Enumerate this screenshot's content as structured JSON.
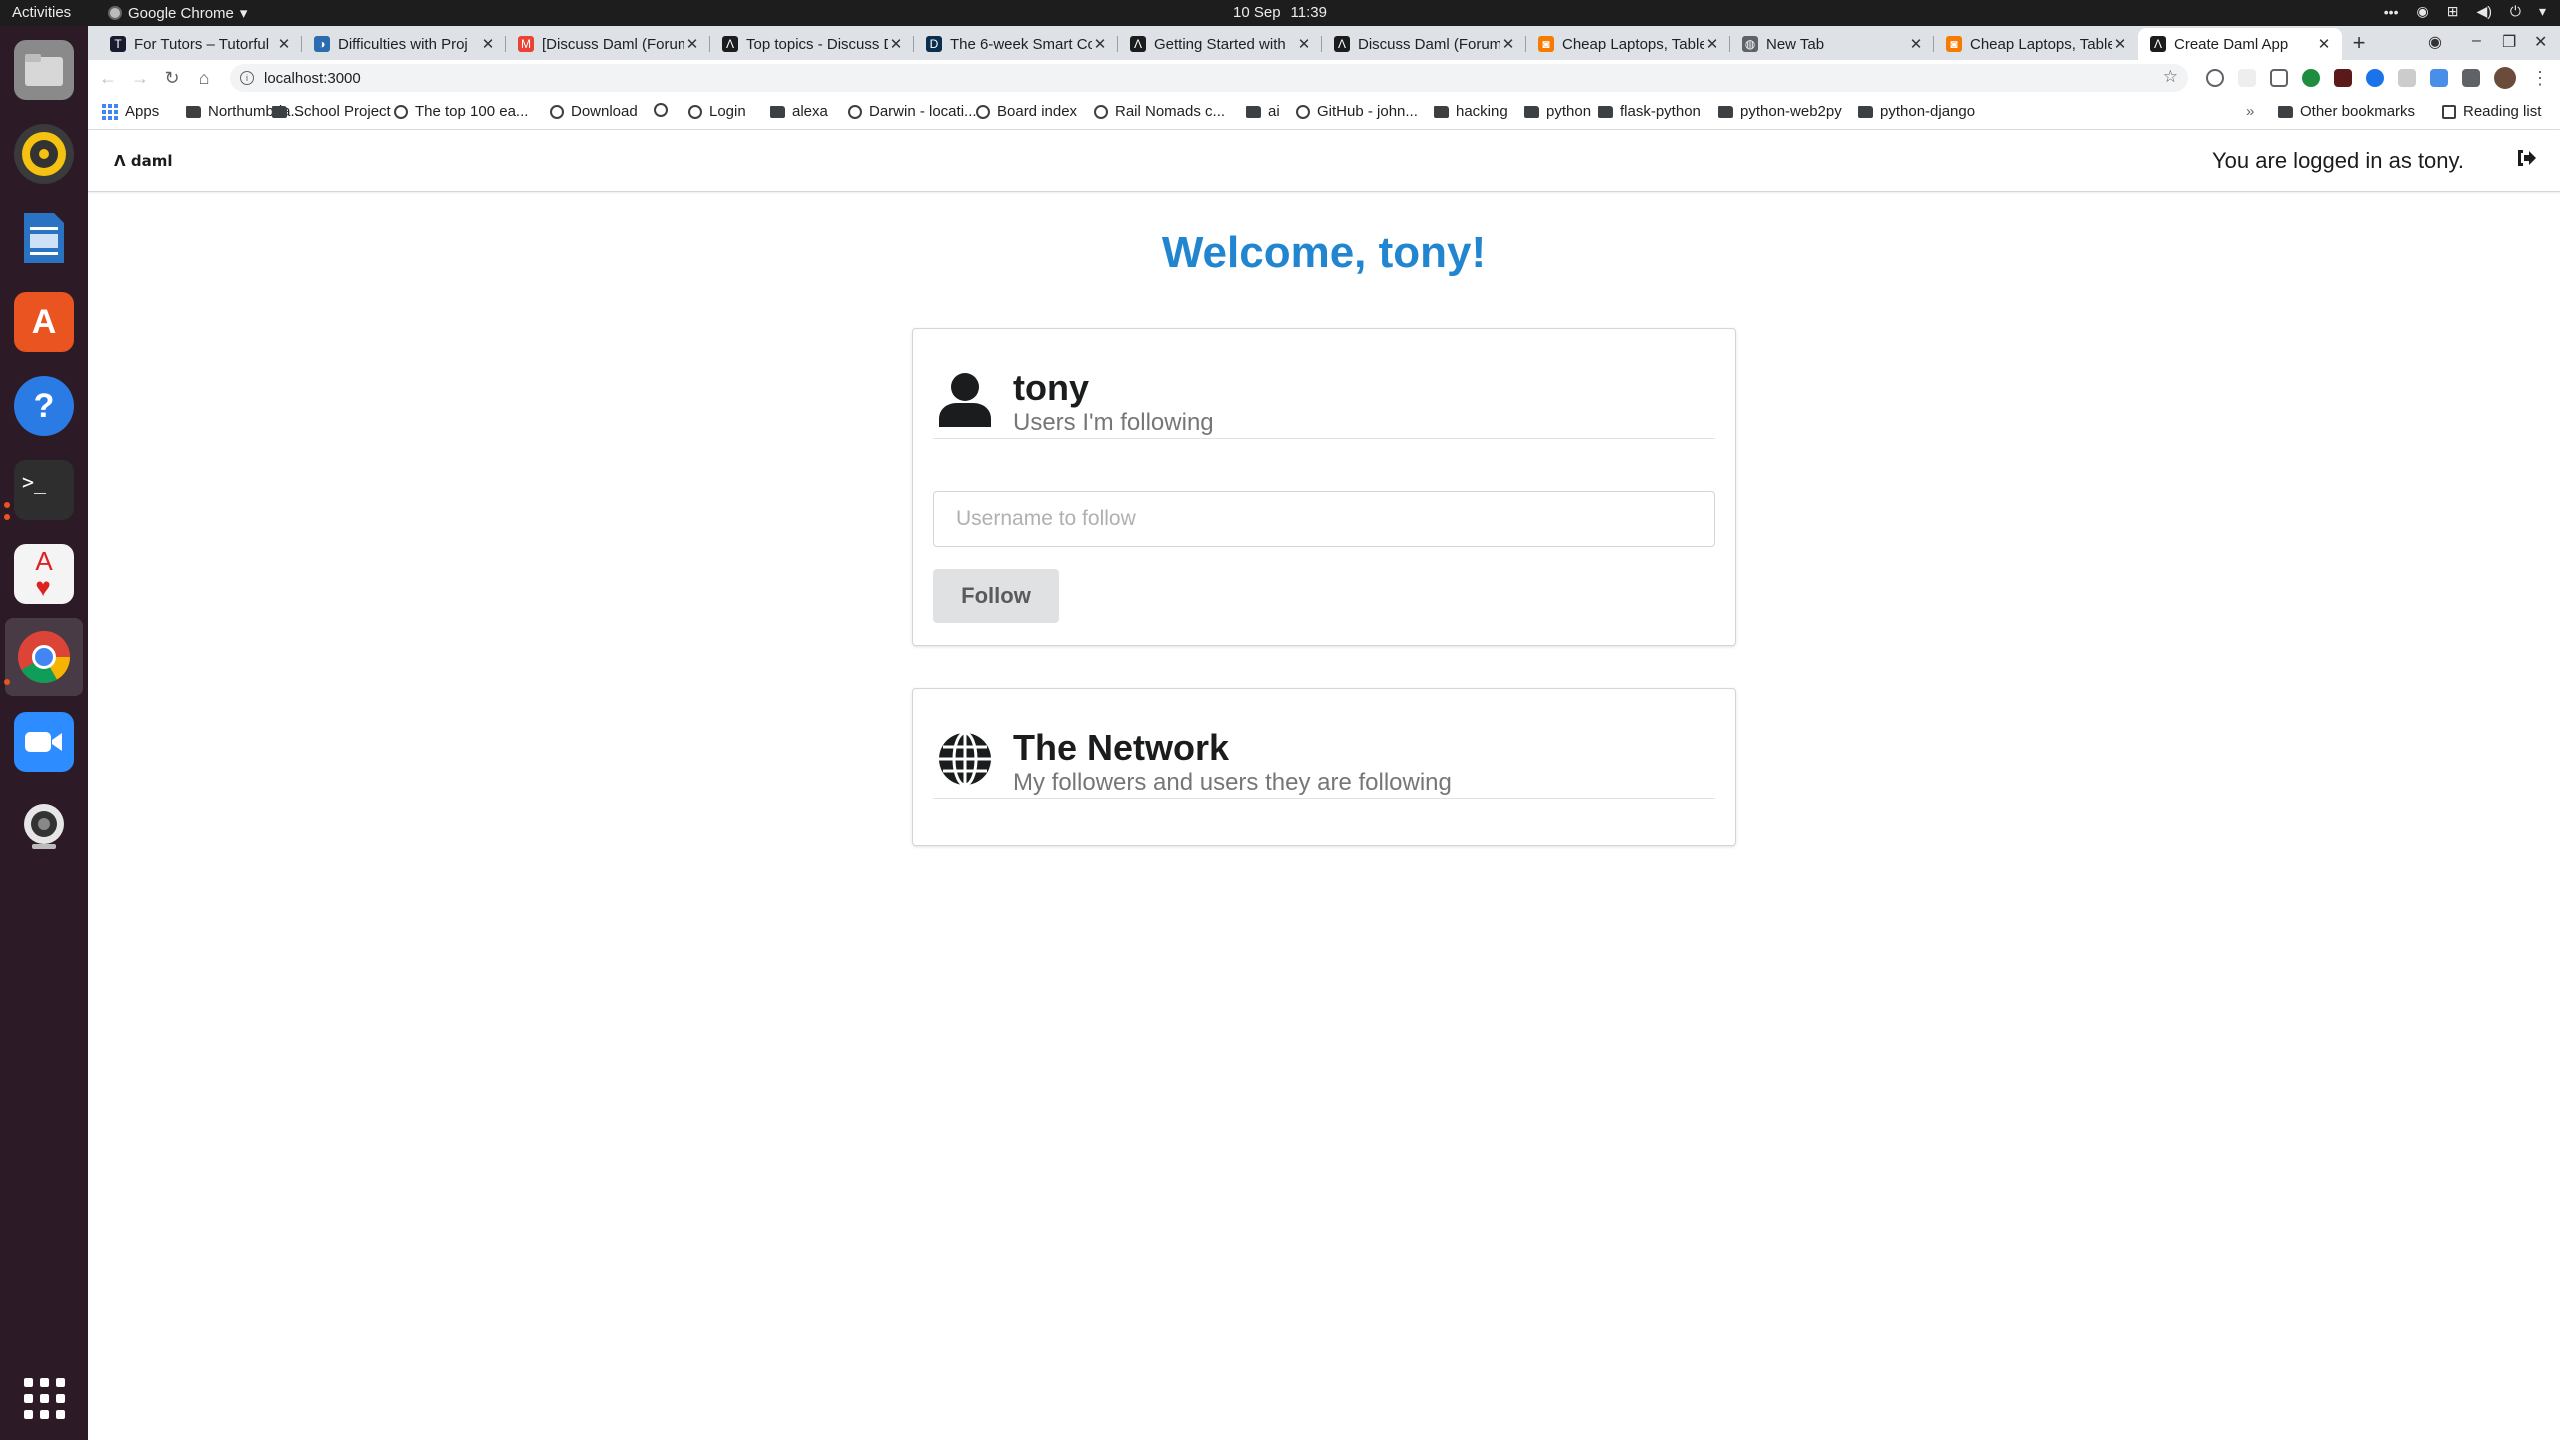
{
  "os": {
    "activities": "Activities",
    "app_name": "Google Chrome",
    "clock": {
      "date": "10 Sep",
      "time": "11:39"
    }
  },
  "dock": [
    "files-icon",
    "rhythmbox-icon",
    "writer-icon",
    "app-center-icon",
    "help-icon",
    "terminal-icon",
    "solitaire-icon",
    "chrome-icon",
    "zoom-icon",
    "webcam-icon",
    "show-apps-icon"
  ],
  "tabs": [
    {
      "title": "For Tutors – Tutorful",
      "color": "#1a1a2e",
      "glyph": "T"
    },
    {
      "title": "Difficulties with Proj",
      "color": "#2b6cb0",
      "glyph": "◑"
    },
    {
      "title": "[Discuss Daml (Forum",
      "color": "#ea4335",
      "glyph": "M"
    },
    {
      "title": "Top topics - Discuss D",
      "color": "#1b1c1d",
      "glyph": "Λ"
    },
    {
      "title": "The 6-week Smart Co",
      "color": "#0b2e4f",
      "glyph": "D"
    },
    {
      "title": "Getting Started with",
      "color": "#1b1c1d",
      "glyph": "Λ"
    },
    {
      "title": "Discuss Daml (Forum",
      "color": "#1b1c1d",
      "glyph": "Λ"
    },
    {
      "title": "Cheap Laptops, Table",
      "color": "#f57c00",
      "glyph": "◙"
    },
    {
      "title": "New Tab",
      "color": "#5f6368",
      "glyph": "◍"
    },
    {
      "title": "Cheap Laptops, Table",
      "color": "#f57c00",
      "glyph": "◙"
    },
    {
      "title": "Create Daml App",
      "color": "#1b1c1d",
      "glyph": "Λ",
      "active": true
    }
  ],
  "address": {
    "url": "localhost:3000"
  },
  "bookmarks": {
    "apps": "Apps",
    "items": [
      {
        "label": "Northumbria...",
        "kind": "folder"
      },
      {
        "label": "School Project",
        "kind": "folder"
      },
      {
        "label": "The top 100 ea...",
        "kind": "globe"
      },
      {
        "label": "Download",
        "kind": "globe"
      },
      {
        "label": "",
        "kind": "globe"
      },
      {
        "label": "Login",
        "kind": "globe"
      },
      {
        "label": "alexa",
        "kind": "folder"
      },
      {
        "label": "Darwin - locati...",
        "kind": "globe"
      },
      {
        "label": "Board index",
        "kind": "globe"
      },
      {
        "label": "Rail Nomads c...",
        "kind": "globe"
      },
      {
        "label": "ai",
        "kind": "folder"
      },
      {
        "label": "GitHub - john...",
        "kind": "globe"
      },
      {
        "label": "hacking",
        "kind": "folder"
      },
      {
        "label": "python",
        "kind": "folder"
      },
      {
        "label": "flask-python",
        "kind": "folder"
      },
      {
        "label": "python-web2py",
        "kind": "folder"
      },
      {
        "label": "python-django",
        "kind": "folder"
      }
    ],
    "overflow": "»",
    "other": "Other bookmarks",
    "reading_list": "Reading list"
  },
  "app": {
    "logo": "Λ daml",
    "logged_in": "You are logged in as tony.",
    "welcome": "Welcome, tony!",
    "user_card": {
      "title": "tony",
      "subtitle": "Users I'm following",
      "input_placeholder": "Username to follow",
      "follow_button": "Follow"
    },
    "network_card": {
      "title": "The Network",
      "subtitle": "My followers and users they are following"
    },
    "accent": "#2185d0"
  }
}
